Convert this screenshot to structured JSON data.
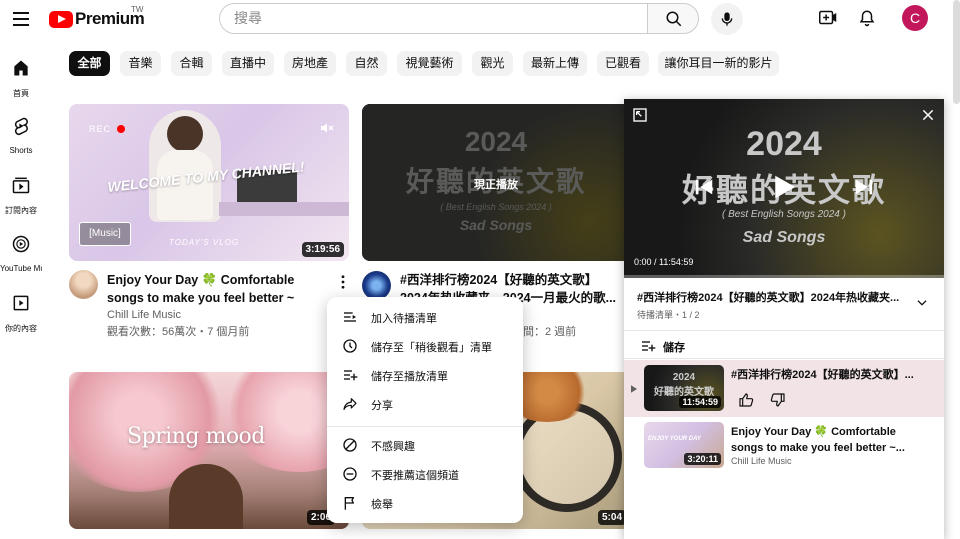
{
  "header": {
    "logo_text": "Premium",
    "logo_region": "TW",
    "search_placeholder": "搜尋",
    "avatar_letter": "C"
  },
  "sidebar": {
    "items": [
      {
        "label": "首頁",
        "icon": "home-icon"
      },
      {
        "label": "Shorts",
        "icon": "shorts-icon"
      },
      {
        "label": "訂閱內容",
        "icon": "subscriptions-icon"
      },
      {
        "label": "YouTube Mu...",
        "icon": "youtube-music-icon"
      },
      {
        "label": "你的內容",
        "icon": "library-icon"
      }
    ]
  },
  "chips": [
    "全部",
    "音樂",
    "合輯",
    "直播中",
    "房地產",
    "自然",
    "視覺藝術",
    "觀光",
    "最新上傳",
    "已觀看",
    "讓你耳目一新的影片"
  ],
  "videos": [
    {
      "title": "Enjoy Your Day 🍀 Comfortable songs to make you feel better ~ Morning...",
      "channel": "Chill Life Music",
      "meta": "觀看次數：56萬次・7 個月前",
      "duration": "3:19:56",
      "thumb_tag": "[Music]",
      "thumb_text": "WELCOME TO MY CHANNEL!",
      "thumb_sub": "TODAY'S VLOG",
      "thumb_rec": "REC"
    },
    {
      "title": "#西洋排行榜2024【好聽的英文歌】2024年热收藏夹，2024一月最火的歌...",
      "meta": "間：2 週前",
      "now_playing": "現正播放",
      "thumb_line1": "2024",
      "thumb_line2": "好聽的英文歌",
      "thumb_line3": "( Best English Songs 2024 )",
      "thumb_line4": "Sad Songs"
    },
    {
      "duration": "2:06",
      "thumb_text": "Spring mood"
    },
    {
      "duration": "5:04"
    }
  ],
  "context_menu": {
    "items": [
      {
        "label": "加入待播清單",
        "icon": "queue-icon"
      },
      {
        "label": "儲存至「稍後觀看」清單",
        "icon": "clock-icon"
      },
      {
        "label": "儲存至播放清單",
        "icon": "playlist-add-icon"
      },
      {
        "label": "分享",
        "icon": "share-icon"
      },
      {
        "label": "不感興趣",
        "icon": "not-interested-icon"
      },
      {
        "label": "不要推薦這個頻道",
        "icon": "dont-recommend-icon"
      },
      {
        "label": "檢舉",
        "icon": "flag-icon"
      }
    ]
  },
  "miniplayer": {
    "time": "0:00 / 11:54:59",
    "video_line1": "2024",
    "video_line2": "好聽的英文歌",
    "video_line3": "( Best English Songs 2024 )",
    "video_line4": "Sad Songs",
    "playlist_title": "#西洋排行榜2024【好聽的英文歌】2024年热收藏夹...",
    "playlist_sub": "待播清單・1 / 2",
    "save_label": "儲存",
    "items": [
      {
        "title": "#西洋排行榜2024【好聽的英文歌】...",
        "duration": "11:54:59",
        "thumb_line1": "2024",
        "thumb_line2": "好聽的英文歌"
      },
      {
        "title": "Enjoy Your Day 🍀 Comfortable songs to make you feel better ~...",
        "channel": "Chill Life Music",
        "duration": "3:20:11",
        "thumb_text": "ENJOY YOUR DAY"
      }
    ]
  }
}
